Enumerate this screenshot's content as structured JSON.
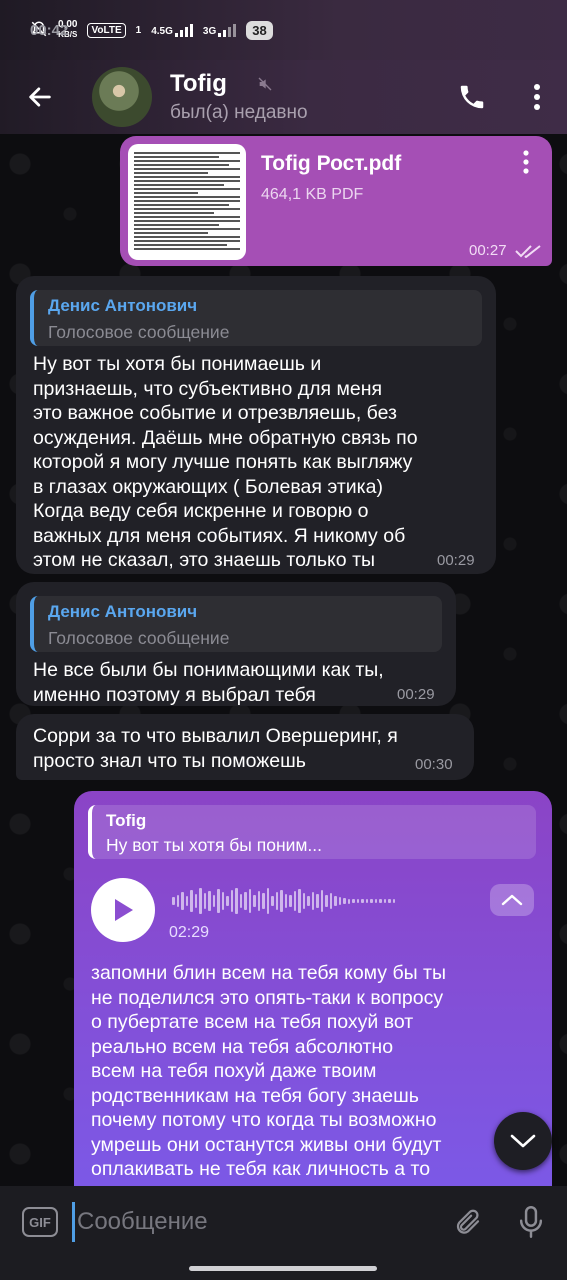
{
  "status_bar": {
    "time": "00:42",
    "speed": "0,00",
    "speed_unit": "KB/S",
    "volte": "VoLTE",
    "sim1": "1",
    "net1": "4.5G",
    "net2": "3G",
    "battery": "38"
  },
  "header": {
    "name": "Tofig",
    "status": "был(а) недавно",
    "muted": true
  },
  "messages": {
    "file": {
      "filename": "Tofig Рост.pdf",
      "size": "464,1 KB PDF",
      "time": "00:27",
      "read": true
    },
    "m1": {
      "reply_name": "Денис Антонович",
      "reply_text": "Голосовое сообщение",
      "lines": [
        "Ну вот ты хотя бы понимаешь и",
        "признаешь, что субъективно для меня",
        "это важное событие и отрезвляешь, без",
        "осуждения. Даёшь мне обратную связь по",
        "которой я могу лучше понять как выгляжу",
        "в глазах окружающих ( Болевая этика)",
        "Когда веду себя искренне и говорю о",
        "важных для меня событиях. Я никому об",
        "этом не сказал, это знаешь только ты"
      ],
      "time": "00:29"
    },
    "m2": {
      "reply_name": "Денис Антонович",
      "reply_text": "Голосовое сообщение",
      "lines": [
        "Не все были бы понимающими как ты,",
        "именно поэтому я выбрал тебя"
      ],
      "time": "00:29"
    },
    "m3": {
      "lines": [
        "Сорри за то что вывалил Овершеринг, я",
        "просто знал что ты поможешь"
      ],
      "time": "00:30"
    },
    "m4": {
      "reply_name": "Tofig",
      "reply_text": "Ну вот ты хотя бы поним...",
      "voice_duration": "02:29",
      "lines": [
        "запомни блин всем на тебя кому бы ты",
        "не поделился это опять-таки к вопросу",
        "о пубертате всем на тебя похуй вот",
        "реально всем на тебя абсолютно",
        "всем на тебя похуй даже твоим",
        "родственникам на тебя богу знаешь",
        "почему потому что когда ты возможно",
        "умрешь они останутся живы они будут",
        "оплакивать не тебя как личность а то"
      ]
    }
  },
  "input": {
    "placeholder": "Сообщение",
    "gif_label": "GIF"
  },
  "colors": {
    "header_accent": "#3f2c47",
    "outgoing_bubble": "#8b44c6",
    "file_bubble": "#a54fb5",
    "incoming_bubble": "#212127",
    "link_blue": "#4f9ee5"
  }
}
